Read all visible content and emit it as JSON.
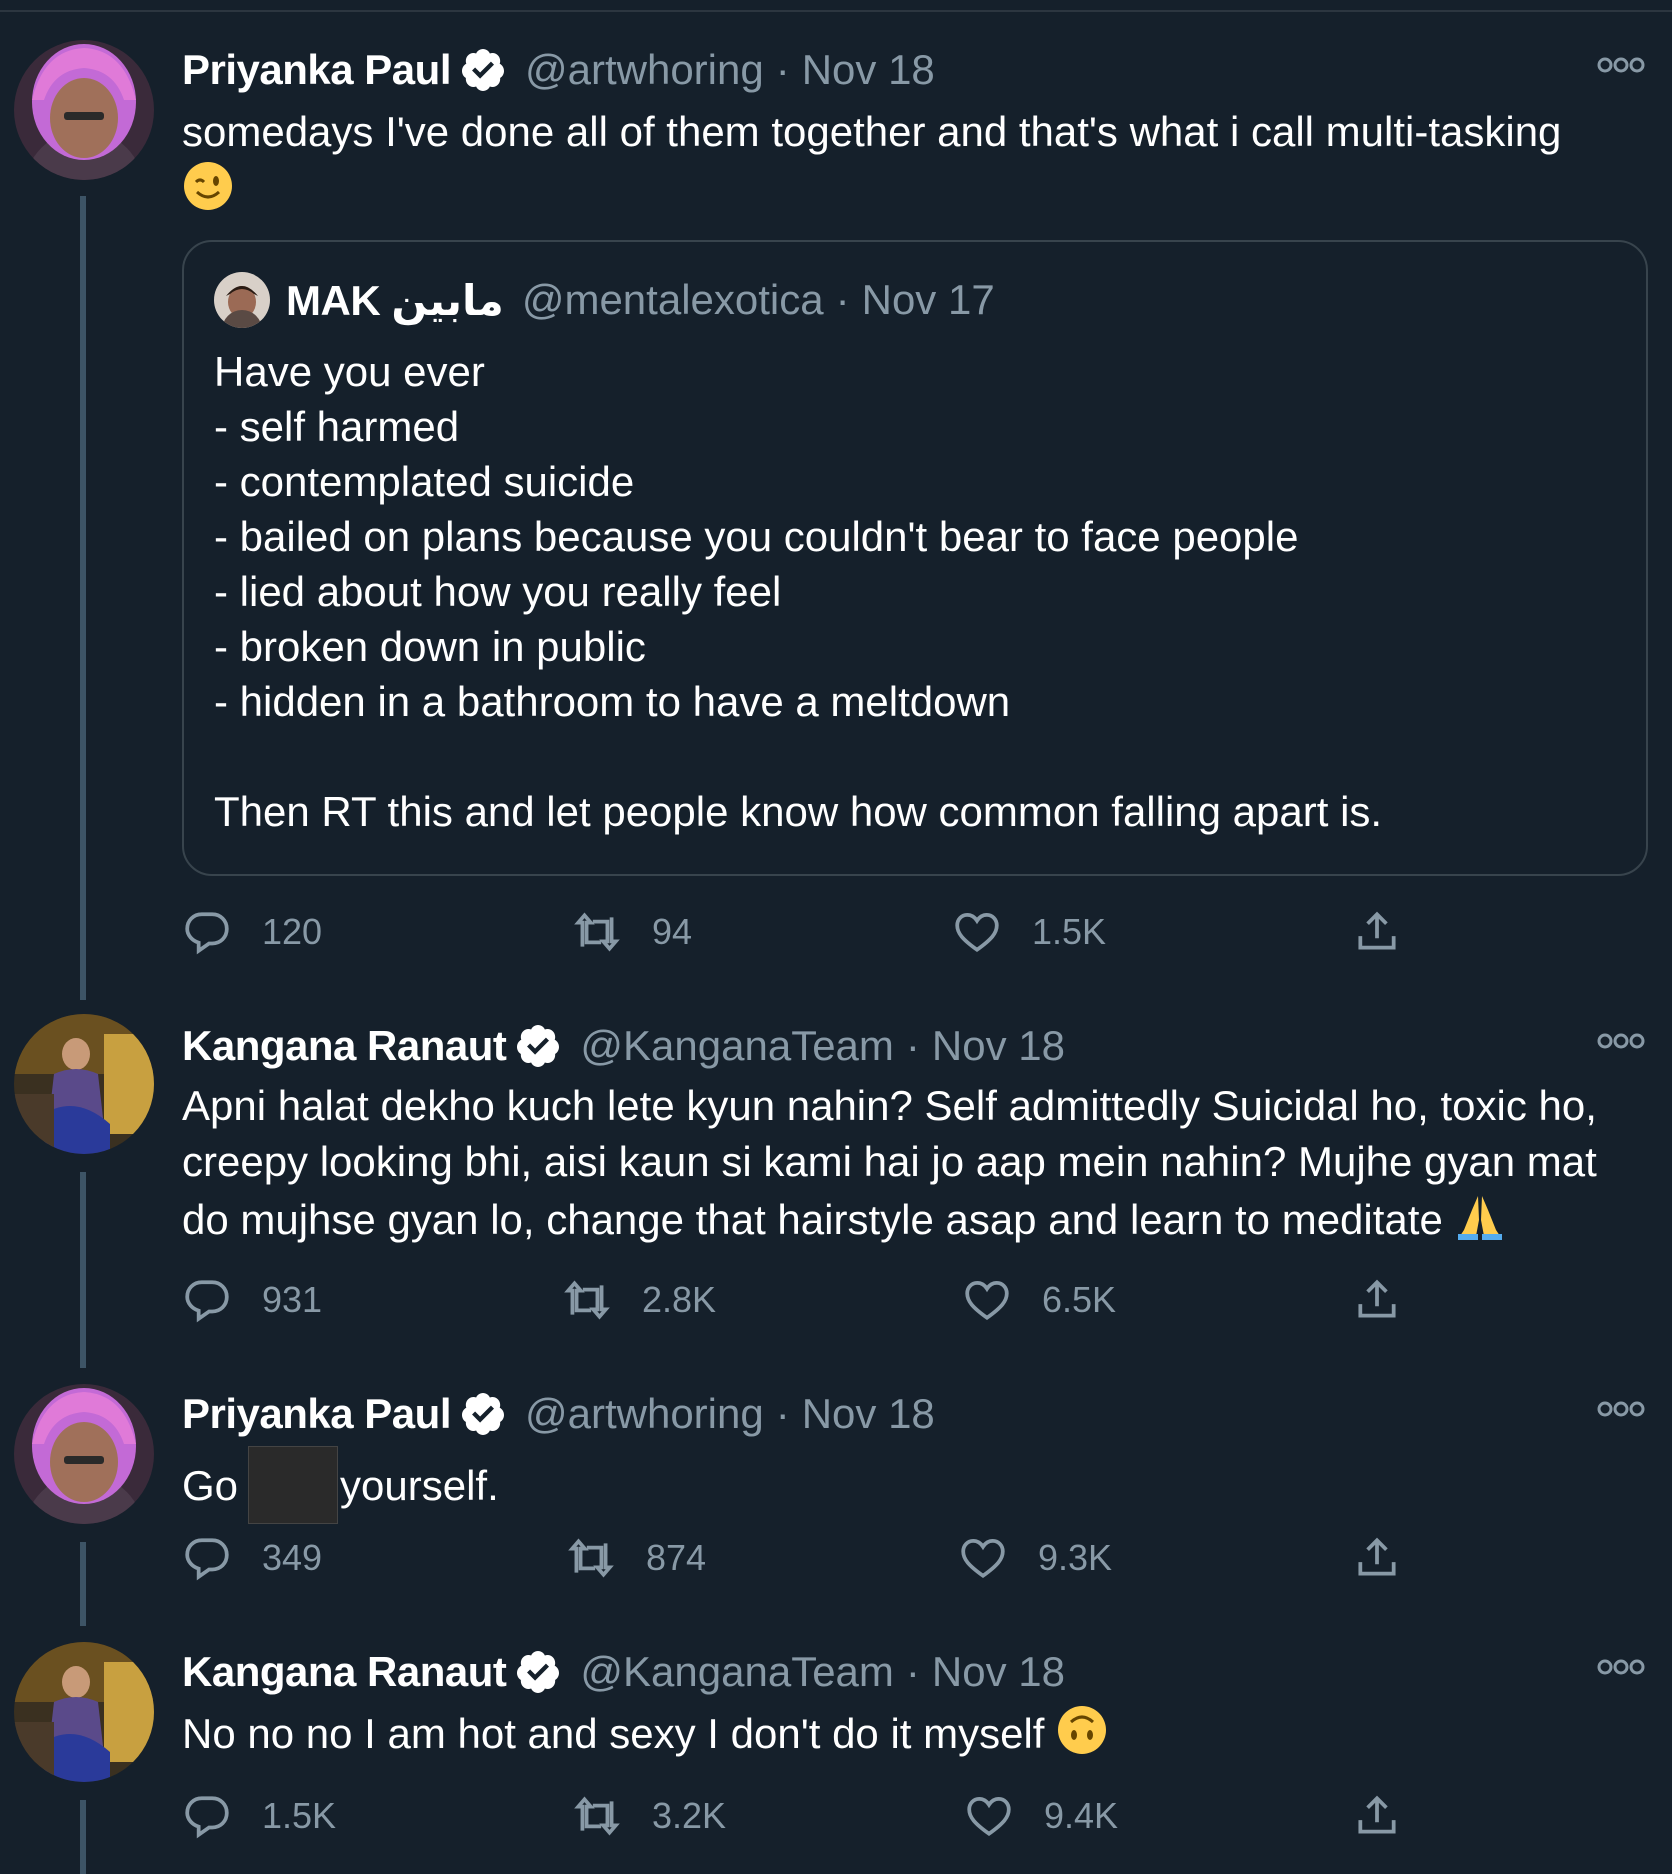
{
  "tweets": [
    {
      "name": "Priyanka Paul",
      "handle": "@artwhoring",
      "separator": "·",
      "date": "Nov 18",
      "text": "somedays I've done all of them together and that's what i call multi-tasking",
      "emoji": "winking-face",
      "quote": {
        "name": "MAK مابين",
        "handle": "@mentalexotica",
        "separator": "·",
        "date": "Nov 17",
        "lines": [
          "Have you ever",
          "- self harmed",
          "- contemplated suicide",
          "- bailed on plans because you couldn't bear to face people",
          "- lied about how you really feel",
          "- broken down in public",
          "- hidden in a bathroom to have a meltdown",
          "",
          "Then RT this and let people know how common falling apart is."
        ]
      },
      "replies": "120",
      "retweets": "94",
      "likes": "1.5K"
    },
    {
      "name": "Kangana Ranaut",
      "handle": "@KanganaTeam",
      "separator": "·",
      "date": "Nov 18",
      "text": "Apni halat dekho kuch lete kyun nahin? Self admittedly Suicidal ho, toxic ho, creepy looking bhi, aisi kaun si kami hai jo aap mein nahin? Mujhe gyan mat do mujhse gyan lo, change that hairstyle asap and learn to meditate",
      "emoji": "folded-hands",
      "replies": "931",
      "retweets": "2.8K",
      "likes": "6.5K"
    },
    {
      "name": "Priyanka Paul",
      "handle": "@artwhoring",
      "separator": "·",
      "date": "Nov 18",
      "text_before": "Go",
      "text_after": "yourself.",
      "replies": "349",
      "retweets": "874",
      "likes": "9.3K"
    },
    {
      "name": "Kangana Ranaut",
      "handle": "@KanganaTeam",
      "separator": "·",
      "date": "Nov 18",
      "text": "No no no I am hot and sexy I don't do it myself",
      "emoji": "upside-down-face",
      "replies": "1.5K",
      "retweets": "3.2K",
      "likes": "9.4K"
    }
  ],
  "colors": {
    "background": "#15202b",
    "text_primary": "#ffffff",
    "text_secondary": "#8899a6",
    "border": "#38444d",
    "thread_line": "#3d5466"
  }
}
